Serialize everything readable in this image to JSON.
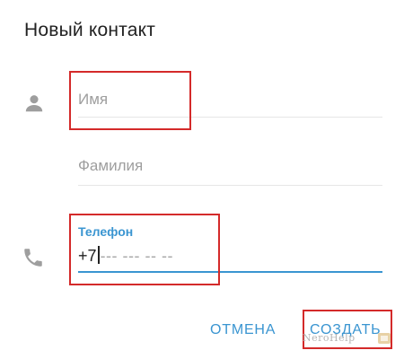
{
  "dialog": {
    "title": "Новый контакт"
  },
  "fields": {
    "first_name": {
      "placeholder": "Имя",
      "icon": "person-icon"
    },
    "last_name": {
      "placeholder": "Фамилия"
    },
    "phone": {
      "label": "Телефон",
      "value": "+7",
      "mask": "--- --- -- --",
      "icon": "phone-icon"
    }
  },
  "actions": {
    "cancel_label": "ОТМЕНА",
    "create_label": "СОЗДАТЬ"
  },
  "watermark": {
    "text": "NeroHelp"
  },
  "colors": {
    "accent": "#3a95d1",
    "annotation": "#d42a2a",
    "icon": "#9e9e9e"
  }
}
